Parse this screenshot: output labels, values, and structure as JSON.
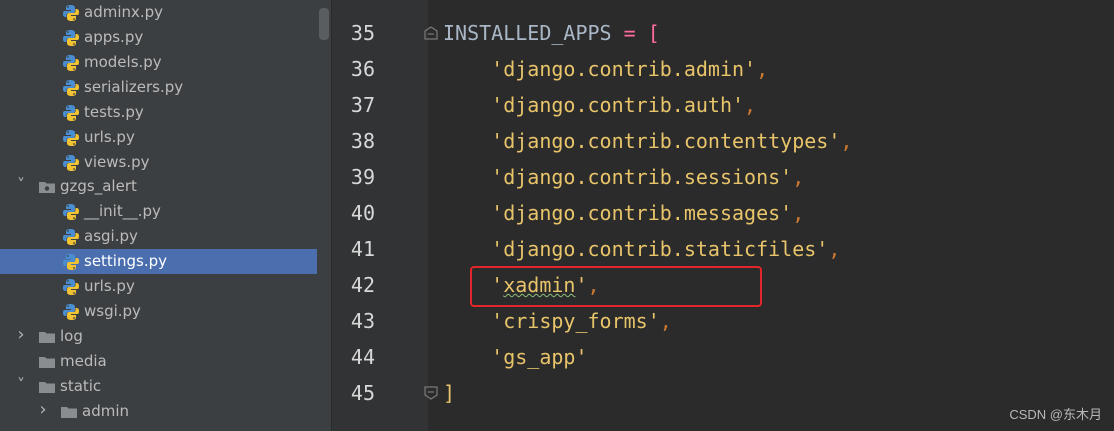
{
  "project_tree": {
    "items": [
      {
        "label": "adminx.py",
        "kind": "python-file"
      },
      {
        "label": "apps.py",
        "kind": "python-file"
      },
      {
        "label": "models.py",
        "kind": "python-file"
      },
      {
        "label": "serializers.py",
        "kind": "python-file"
      },
      {
        "label": "tests.py",
        "kind": "python-file"
      },
      {
        "label": "urls.py",
        "kind": "python-file"
      },
      {
        "label": "views.py",
        "kind": "python-file"
      },
      {
        "label": "gzgs_alert",
        "kind": "package-folder",
        "expanded": true
      },
      {
        "label": "__init__.py",
        "kind": "python-file"
      },
      {
        "label": "asgi.py",
        "kind": "python-file"
      },
      {
        "label": "settings.py",
        "kind": "python-file",
        "selected": true
      },
      {
        "label": "urls.py",
        "kind": "python-file"
      },
      {
        "label": "wsgi.py",
        "kind": "python-file"
      },
      {
        "label": "log",
        "kind": "folder",
        "expanded": false
      },
      {
        "label": "media",
        "kind": "folder"
      },
      {
        "label": "static",
        "kind": "folder",
        "expanded": true
      },
      {
        "label": "admin",
        "kind": "folder",
        "expanded": false
      }
    ]
  },
  "editor": {
    "line_numbers": [
      "35",
      "36",
      "37",
      "38",
      "39",
      "40",
      "41",
      "42",
      "43",
      "44",
      "45"
    ],
    "lines": {
      "l35_name": "INSTALLED_APPS",
      "l35_eq": " = ",
      "l35_bracket": "[",
      "l36": "'django.contrib.admin'",
      "l37": "'django.contrib.auth'",
      "l38": "'django.contrib.contenttypes'",
      "l39": "'django.contrib.sessions'",
      "l40": "'django.contrib.messages'",
      "l41": "'django.contrib.staticfiles'",
      "l42_q1": "'",
      "l42_word": "xadmin",
      "l42_q2": "'",
      "l43": "'crispy_forms'",
      "l44": "'gs_app'",
      "l45": "]",
      "comma": ","
    }
  },
  "colors": {
    "editor_bg": "#2b2b2b",
    "sidebar_bg": "#3c3f41",
    "selection": "#4b6eaf",
    "string": "#e8c46a",
    "highlight_box": "#e3262b"
  },
  "watermark": "CSDN @东木月"
}
